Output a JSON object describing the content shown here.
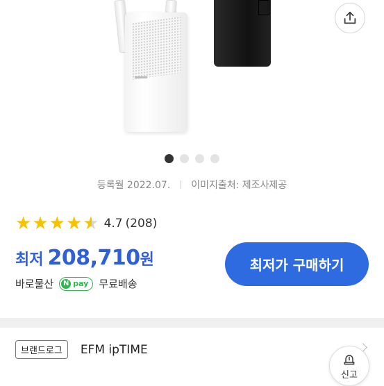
{
  "product": {
    "registered": "등록월 2022.07.",
    "image_source": "이미지출처: 제조사제공",
    "rating": {
      "score": "4.7",
      "count": "(208)",
      "stars": 4.5
    },
    "price": {
      "prefix": "최저",
      "value": "208,710",
      "unit": "원"
    },
    "buy_button": "최저가 구매하기",
    "seller": "바로물산",
    "npay": "pay",
    "shipping": "무료배송",
    "brand_badge": "브랜드로그",
    "brand_name": "EFM ipTIME",
    "report_label": "신고"
  },
  "gallery": {
    "total": 4,
    "active": 1
  },
  "colors": {
    "accent": "#2f6be0",
    "price": "#2f5fd6",
    "star": "#f7c200",
    "npay": "#2bb84c"
  },
  "icons": [
    "share-icon",
    "siren-icon",
    "chevron-right-icon",
    "star-icon"
  ]
}
